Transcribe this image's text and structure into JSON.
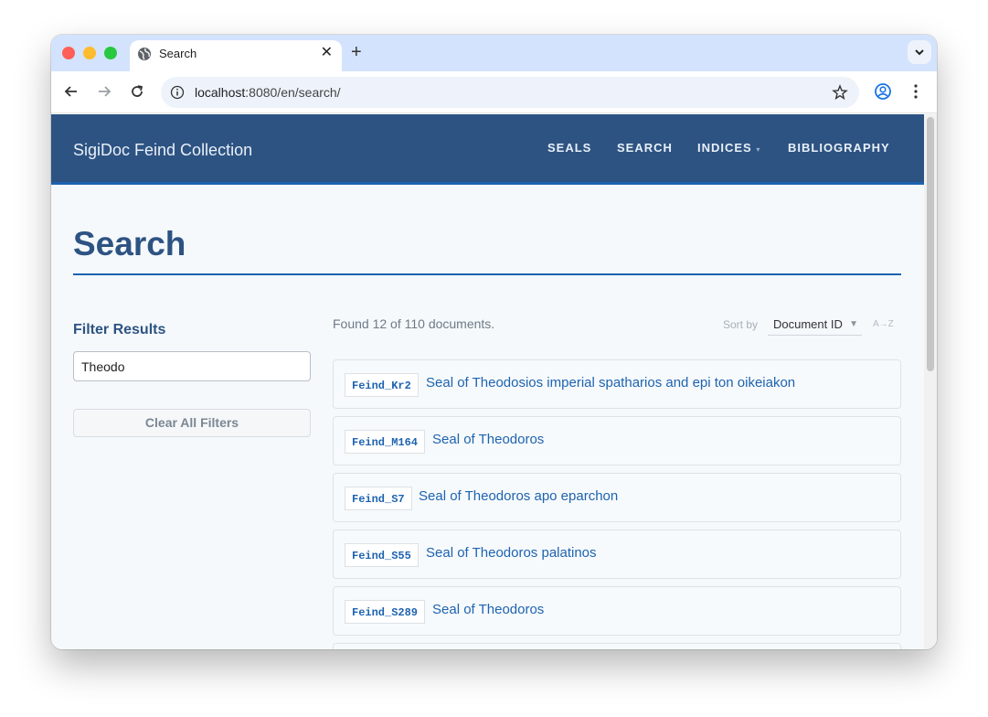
{
  "browser": {
    "tab_title": "Search",
    "url_host": "localhost",
    "url_rest": ":8080/en/search/"
  },
  "site": {
    "title": "SigiDoc Feind Collection",
    "nav": [
      {
        "label": "SEALS"
      },
      {
        "label": "SEARCH"
      },
      {
        "label": "INDICES",
        "caret": "▾"
      },
      {
        "label": "BIBLIOGRAPHY"
      }
    ]
  },
  "page": {
    "title": "Search",
    "filter_heading": "Filter Results",
    "filter_value": "Theodo",
    "clear_label": "Clear All Filters",
    "results_count": "Found 12 of 110 documents.",
    "sort_label": "Sort by",
    "sort_value": "Document ID",
    "sort_direction": "A→Z"
  },
  "results": [
    {
      "id": "Feind_Kr2",
      "title": "Seal of Theodosios imperial spatharios and epi ton oikeiakon"
    },
    {
      "id": "Feind_M164",
      "title": "Seal of Theodoros"
    },
    {
      "id": "Feind_S7",
      "title": "Seal of Theodoros apo eparchon"
    },
    {
      "id": "Feind_S55",
      "title": "Seal of Theodoros palatinos"
    },
    {
      "id": "Feind_S289",
      "title": "Seal of Theodoros"
    }
  ],
  "colors": {
    "header_bg": "#2d5382",
    "accent": "#1d63b0",
    "page_bg": "#f5f9fc"
  }
}
